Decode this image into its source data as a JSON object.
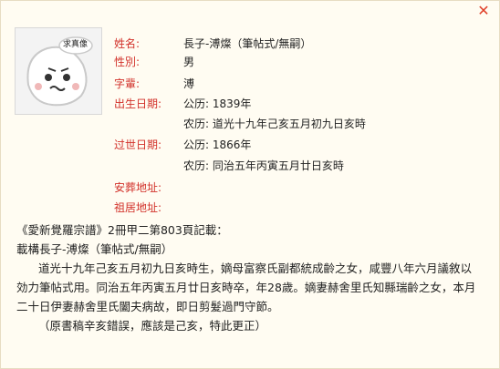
{
  "close_label": "✕",
  "avatar": {
    "badge_text": "求真像"
  },
  "info": {
    "name_label": "姓名:",
    "name_value": "長子-溥燦（筆帖式/無嗣）",
    "gender_label": "性別:",
    "gender_value": "男",
    "generation_label": "字輩:",
    "generation_value": "溥",
    "birth_label": "出生日期:",
    "birth_gregorian": "公历:  1839年",
    "birth_lunar": "农历:  道光十九年己亥五月初九日亥時",
    "death_label": "过世日期:",
    "death_gregorian": "公历:  1866年",
    "death_lunar": "农历:  同治五年丙寅五月廿日亥時",
    "burial_label": "安葬地址:",
    "ancestral_label": "祖居地址:"
  },
  "record": {
    "source": "《愛新覺羅宗譜》2冊甲二第803頁記載：",
    "heading": "載構長子-溥燦（筆帖式/無嗣）",
    "line1": "道光十九年己亥五月初九日亥時生，嫡母富察氏副都統成齡之女，咸豐八年六月議敘以",
    "line2": "効力筆帖式用。同治五年丙寅五月廿日亥時卒，年28歲。嫡妻赫舍里氏知縣瑞齡之女，本月",
    "line3": "二十日伊妻赫舍里氏闔夫病故，即日剪髮過門守節。",
    "line4": "（原書稿辛亥錯誤，應該是己亥，特此更正）"
  }
}
